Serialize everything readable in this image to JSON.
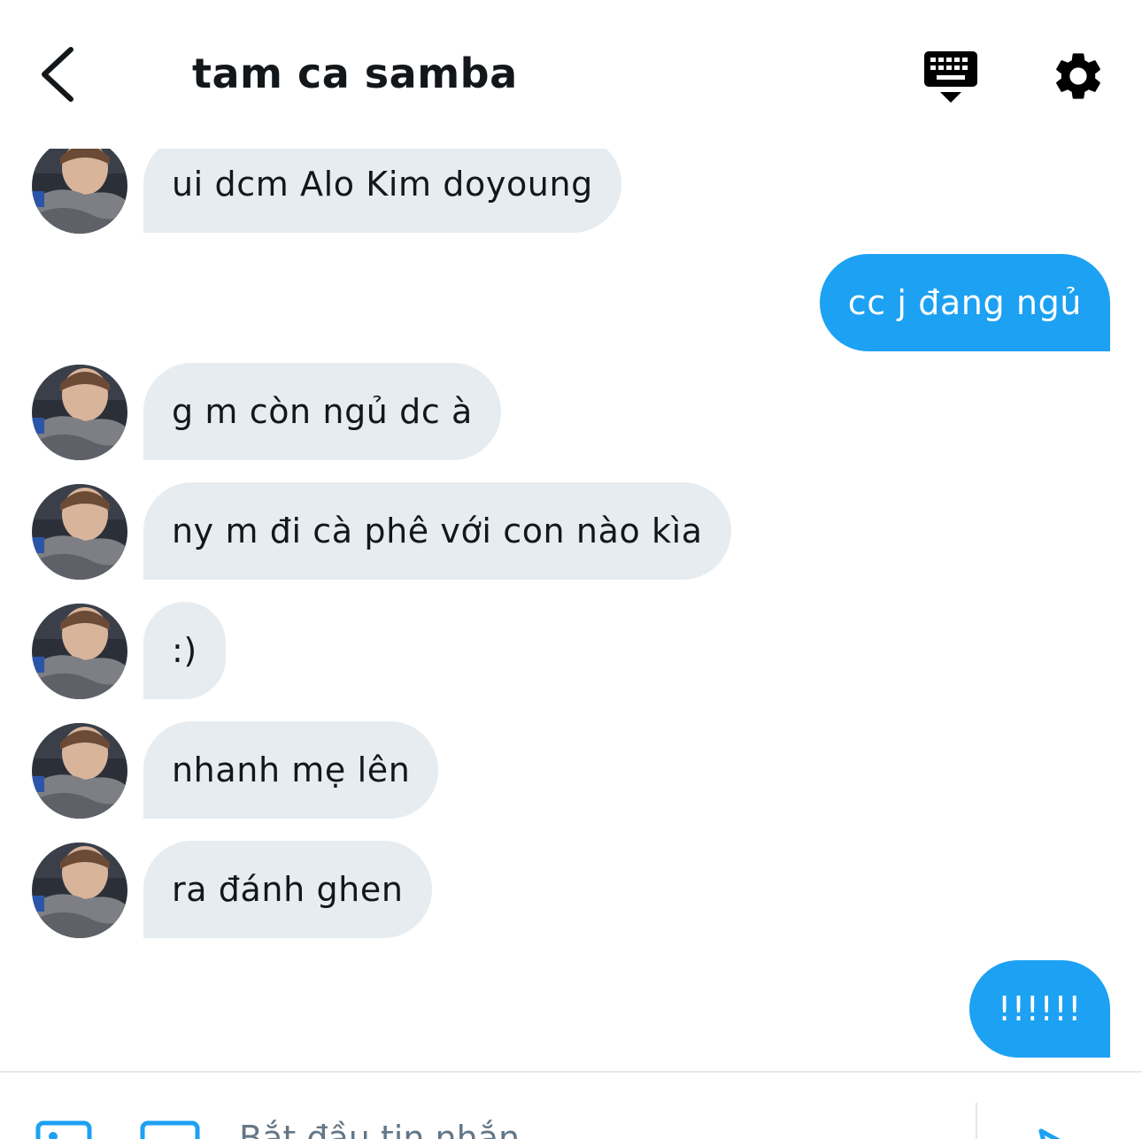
{
  "header": {
    "title": "tam ca samba",
    "back_icon": "chevron-left-icon",
    "keyboard_icon": "keyboard-icon",
    "settings_icon": "gear-icon"
  },
  "messages": [
    {
      "direction": "in",
      "text": "ui dcm Alo Kim doyoung"
    },
    {
      "direction": "out",
      "text": "cc j đang ngủ"
    },
    {
      "direction": "in",
      "text": "g m còn ngủ dc à"
    },
    {
      "direction": "in",
      "text": "ny m đi cà phê với con nào kìa"
    },
    {
      "direction": "in",
      "text": ":)"
    },
    {
      "direction": "in",
      "text": "nhanh mẹ lên"
    },
    {
      "direction": "in",
      "text": "ra đánh ghen"
    },
    {
      "direction": "out",
      "text": "!!!!!!"
    }
  ],
  "composer": {
    "placeholder": "Bắt đầu tin nhắn",
    "media_icon": "image-icon",
    "gif_icon": "gif-icon",
    "send_icon": "send-icon"
  },
  "colors": {
    "accent": "#1da1f2",
    "incoming_bubble": "#e6ecf0",
    "text": "#14171a",
    "divider": "#e1e8ed"
  }
}
